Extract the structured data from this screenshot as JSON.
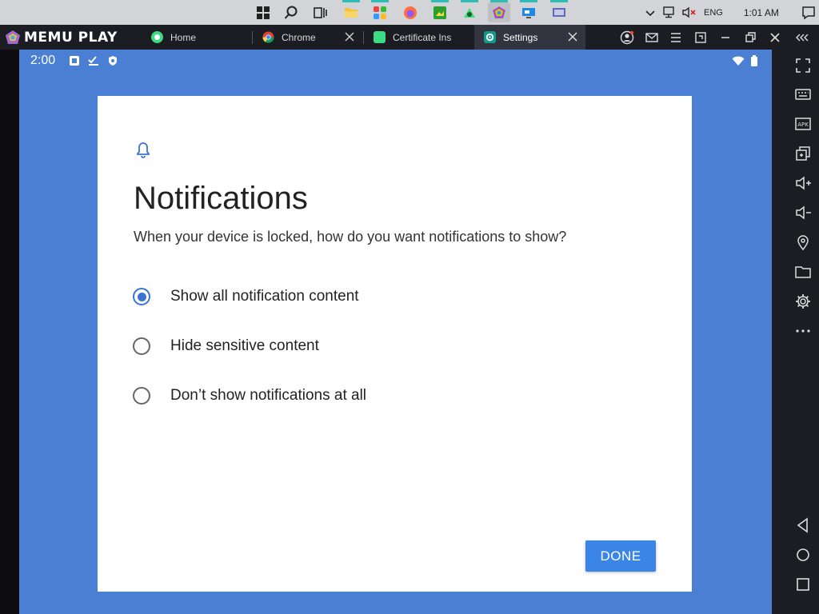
{
  "taskbar": {
    "tray": {
      "language": "ENG",
      "time": "1:01 AM"
    }
  },
  "titlebar": {
    "brand": "MEMU PLAY",
    "tabs": [
      {
        "label": "Home",
        "closable": false,
        "active": false
      },
      {
        "label": "Chrome",
        "closable": true,
        "active": false
      },
      {
        "label": "Certificate Ins",
        "closable": false,
        "active": false
      },
      {
        "label": "Settings",
        "closable": true,
        "active": true
      }
    ]
  },
  "android": {
    "status_time": "2:00",
    "dialog": {
      "title": "Notifications",
      "subtitle": "When your device is locked, how do you want notifications to show?",
      "options": [
        {
          "label": "Show all notification content",
          "selected": true
        },
        {
          "label": "Hide sensitive content",
          "selected": false
        },
        {
          "label": "Don’t show notifications at all",
          "selected": false
        }
      ],
      "done_label": "DONE"
    }
  },
  "colors": {
    "screen_bg": "#4a7fd3",
    "accent": "#3a74d1",
    "done_button": "#3a85e6",
    "titlebar_bg": "#1c1d22"
  },
  "sidebar_icons": [
    "fullscreen-icon",
    "keyboard-icon",
    "apk-icon",
    "multi-window-icon",
    "volume-up-icon",
    "volume-down-icon",
    "location-icon",
    "folder-icon",
    "settings-gear-icon",
    "more-icon",
    "back-icon",
    "home-icon",
    "recents-icon"
  ]
}
